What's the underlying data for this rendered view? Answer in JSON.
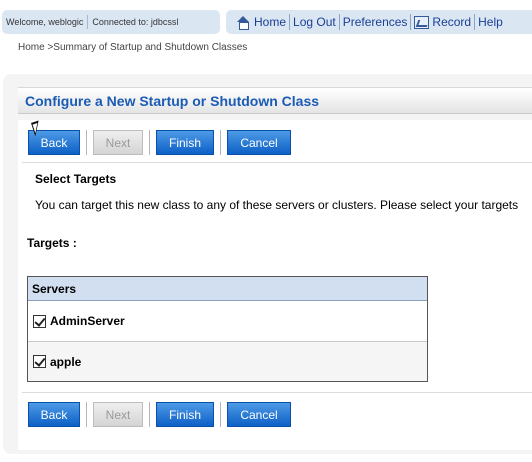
{
  "status": {
    "welcome": "Welcome, weblogic",
    "connected": "Connected to: jdbcssl"
  },
  "toolbar": {
    "home": "Home",
    "logout": "Log Out",
    "preferences": "Preferences",
    "record": "Record",
    "help": "Help"
  },
  "breadcrumb": "Home >Summary of Startup and Shutdown Classes",
  "page": {
    "title": "Configure a New Startup or Shutdown Class"
  },
  "buttons": {
    "back": "Back",
    "next": "Next",
    "finish": "Finish",
    "cancel": "Cancel"
  },
  "section": {
    "title": "Select Targets",
    "description": "You can target this new class to any of these servers or clusters. Please select your targets"
  },
  "targets": {
    "label": "Targets :",
    "servers_header": "Servers",
    "servers": [
      {
        "name": "AdminServer",
        "checked": true
      },
      {
        "name": "apple",
        "checked": true
      }
    ]
  },
  "colors": {
    "accent": "#1b5bb5",
    "button": "#0d60c6",
    "nav_bg": "#dbe6f3"
  }
}
